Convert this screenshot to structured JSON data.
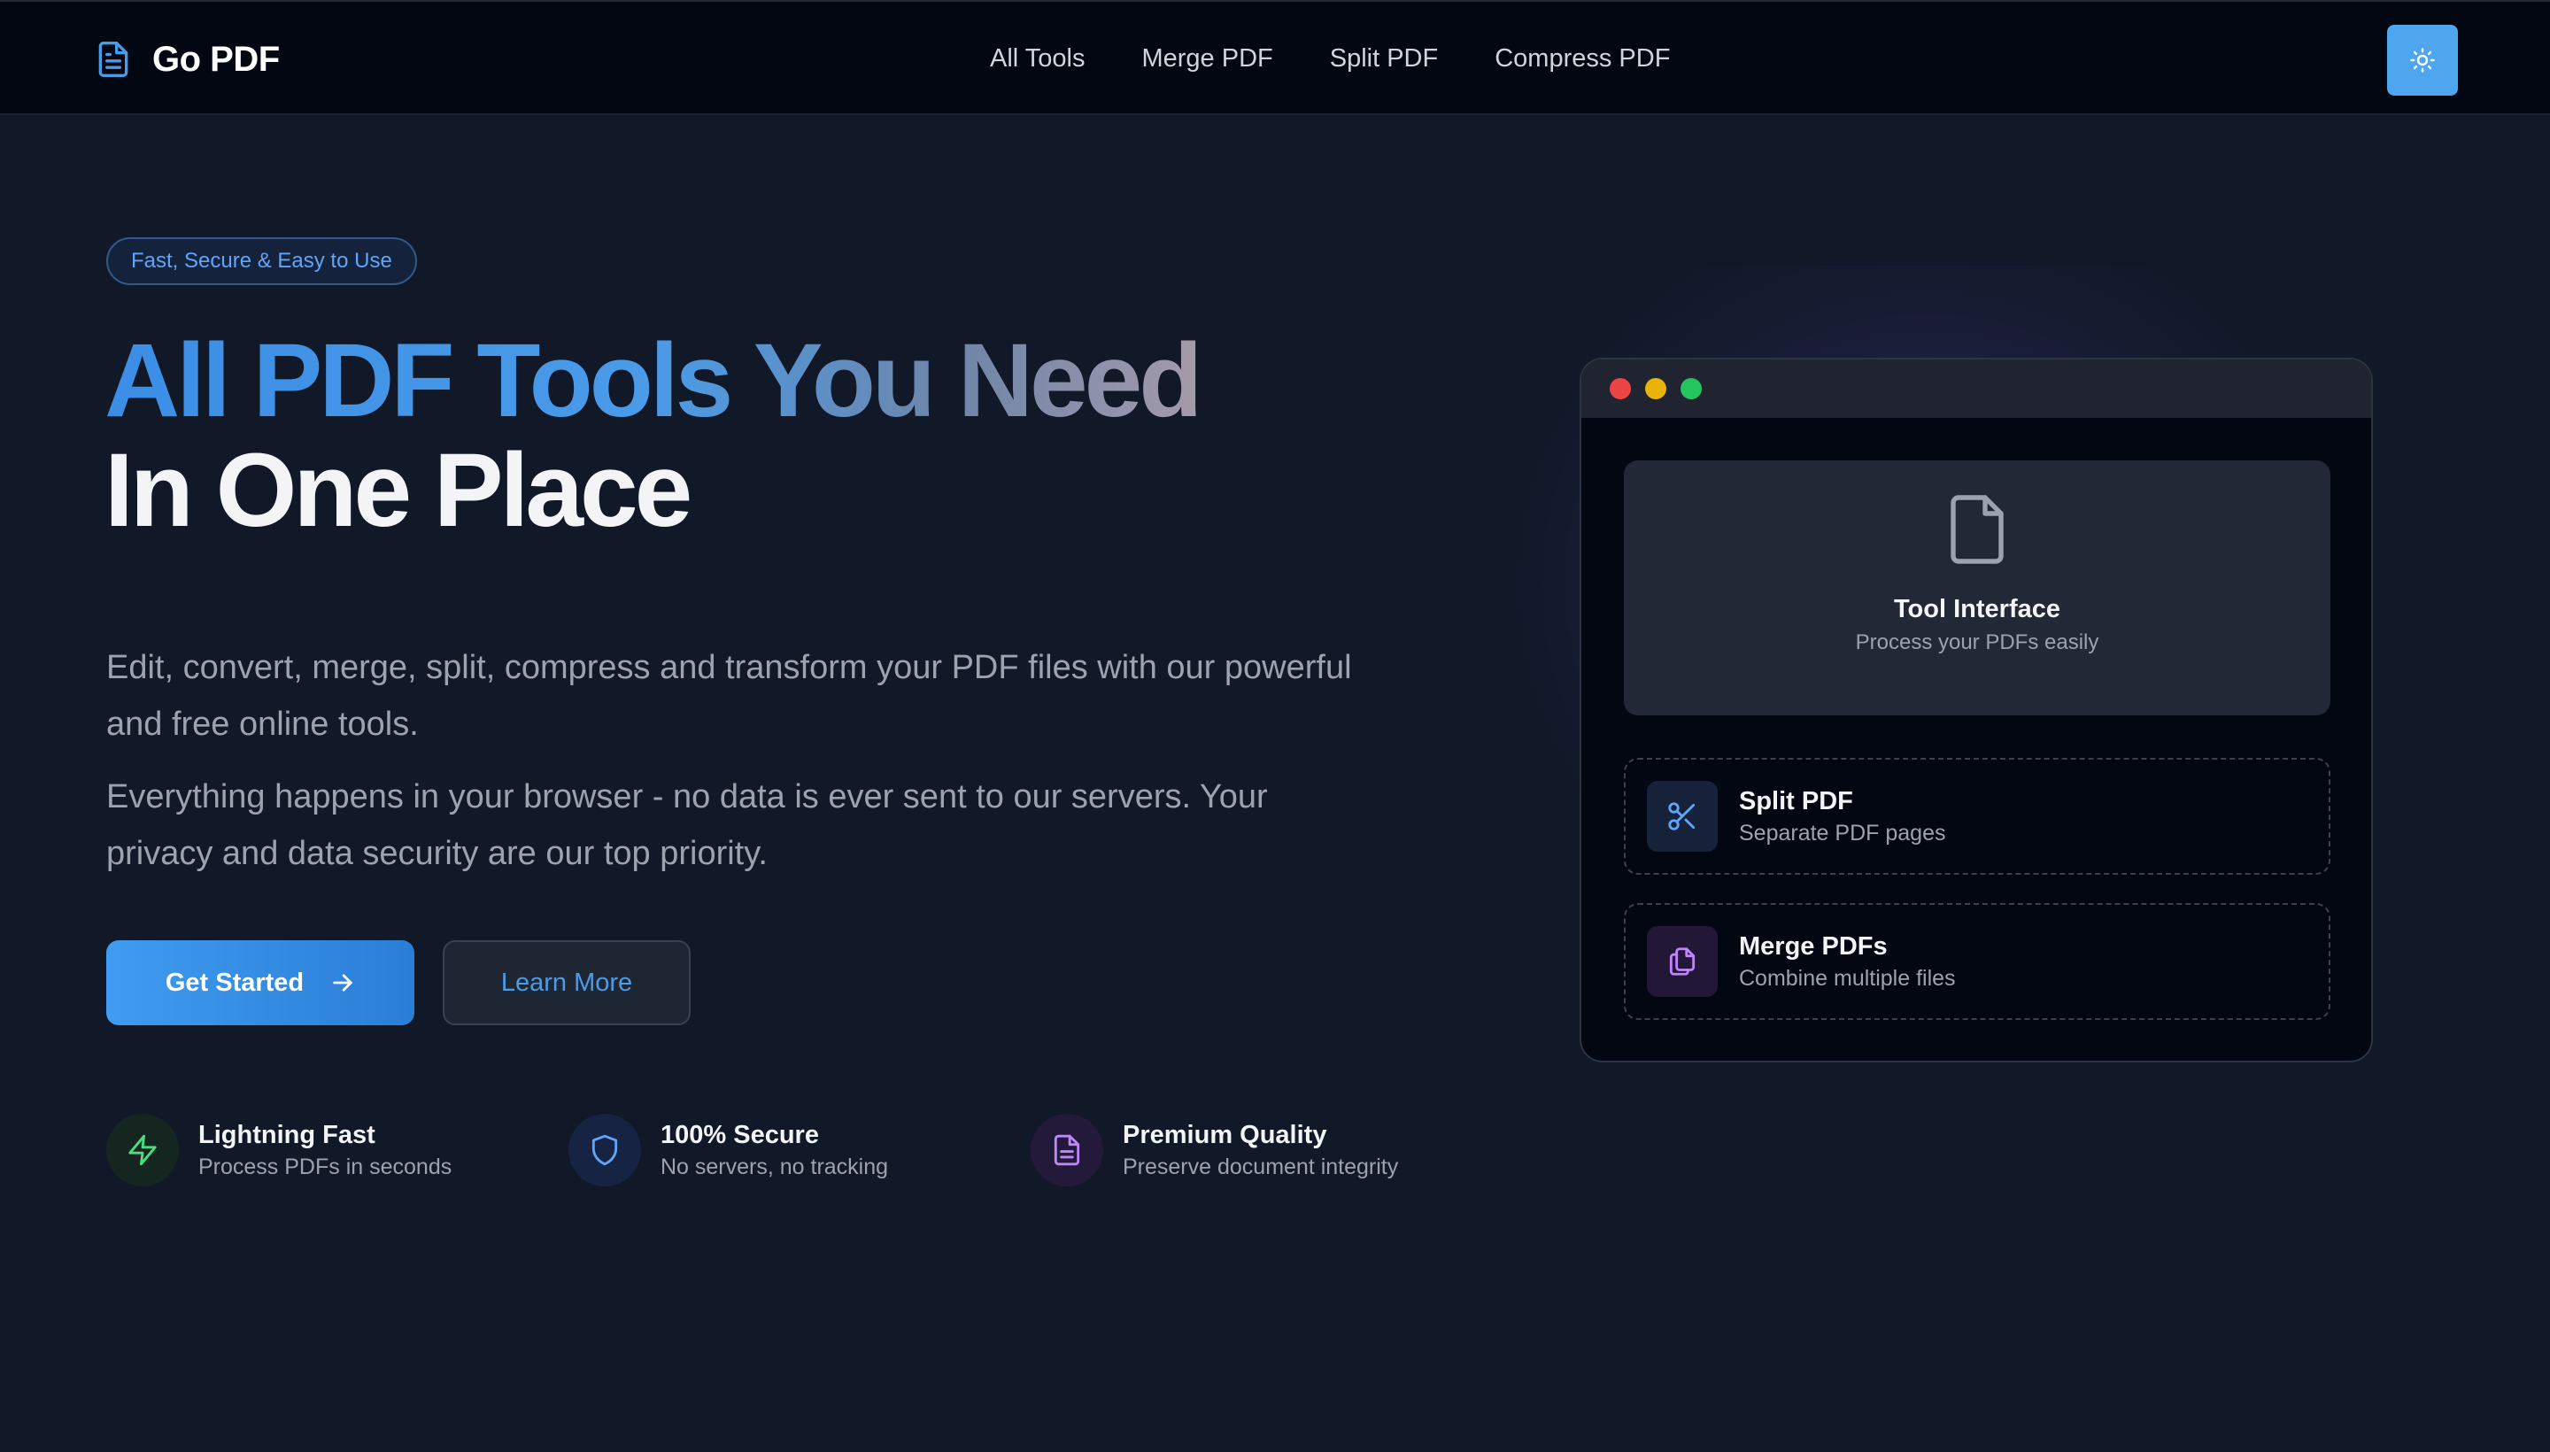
{
  "header": {
    "brand": "Go PDF",
    "nav": [
      "All Tools",
      "Merge PDF",
      "Split PDF",
      "Compress PDF"
    ],
    "theme_toggle_icon": "sun-icon"
  },
  "hero": {
    "badge": "Fast, Secure & Easy to Use",
    "title_line1": "All PDF Tools You Need",
    "title_line2": "In One Place",
    "description1": "Edit, convert, merge, split, compress and transform your PDF files with our powerful and free online tools.",
    "description2": "Everything happens in your browser - no data is ever sent to our servers. Your privacy and data security are our top priority.",
    "primary_button": "Get Started",
    "secondary_button": "Learn More"
  },
  "features": [
    {
      "title": "Lightning Fast",
      "subtitle": "Process PDFs in seconds",
      "icon": "lightning-icon",
      "color": "#4ade80"
    },
    {
      "title": "100% Secure",
      "subtitle": "No servers, no tracking",
      "icon": "shield-icon",
      "color": "#60a5fa"
    },
    {
      "title": "Premium Quality",
      "subtitle": "Preserve document integrity",
      "icon": "document-icon",
      "color": "#c084fc"
    }
  ],
  "preview": {
    "window_dots": [
      "#ef4444",
      "#eab308",
      "#22c55e"
    ],
    "tool_title": "Tool Interface",
    "tool_subtitle": "Process your PDFs easily",
    "cards": [
      {
        "title": "Split PDF",
        "subtitle": "Separate PDF pages",
        "icon": "scissors-icon"
      },
      {
        "title": "Merge PDFs",
        "subtitle": "Combine multiple files",
        "icon": "files-icon"
      }
    ]
  },
  "colors": {
    "accent": "#3b8ee6",
    "background": "#111827",
    "header_bg": "#030712"
  }
}
